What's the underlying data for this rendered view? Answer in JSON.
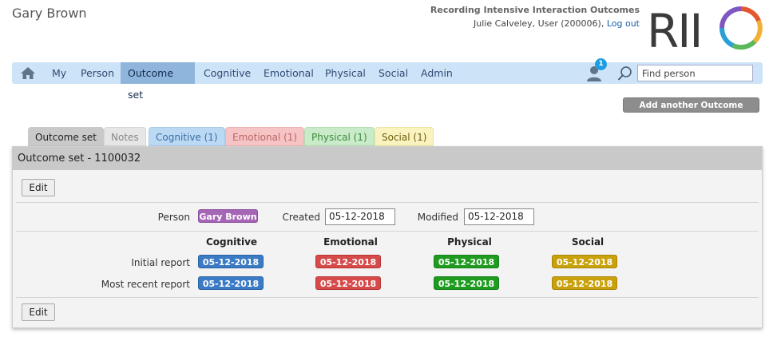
{
  "page": {
    "title": "Gary Brown"
  },
  "header": {
    "app_name": "Recording Intensive Interaction Outcomes",
    "user_text": "Julie Calveley, User (200006),",
    "logout_label": "Log out",
    "logo_text": "RII",
    "logo_icon": "riio-ring-logo"
  },
  "nav": {
    "home_icon": "home-icon",
    "items": [
      {
        "label": "My"
      },
      {
        "label": "Person"
      },
      {
        "label": "Outcome set"
      },
      {
        "label": "Cognitive"
      },
      {
        "label": "Emotional"
      },
      {
        "label": "Physical"
      },
      {
        "label": "Social"
      },
      {
        "label": "Admin"
      }
    ],
    "active_index": 2,
    "notification_count": "1",
    "search_placeholder": "Find person"
  },
  "actions": {
    "add_report_label": "Add another Outcome report"
  },
  "tabs": [
    {
      "label": "Outcome set"
    },
    {
      "label": "Notes"
    },
    {
      "label": "Cognitive (1)"
    },
    {
      "label": "Emotional (1)"
    },
    {
      "label": "Physical (1)"
    },
    {
      "label": "Social (1)"
    }
  ],
  "panel": {
    "title": "Outcome set - 1100032",
    "edit_label": "Edit",
    "person_label": "Person",
    "person_value": "Gary Brown",
    "created_label": "Created",
    "created_value": "05-12-2018",
    "modified_label": "Modified",
    "modified_value": "05-12-2018",
    "columns": [
      "Cognitive",
      "Emotional",
      "Physical",
      "Social"
    ],
    "rows": [
      {
        "label": "Initial report",
        "values": [
          "05-12-2018",
          "05-12-2018",
          "05-12-2018",
          "05-12-2018"
        ]
      },
      {
        "label": "Most recent report",
        "values": [
          "05-12-2018",
          "05-12-2018",
          "05-12-2018",
          "05-12-2018"
        ]
      }
    ]
  },
  "colors": {
    "nav_bg": "#cde3f7",
    "cognitive": "#3b7ac4",
    "emotional": "#d64a4a",
    "physical": "#1f9c1f",
    "social": "#c9a10a",
    "person": "#a566b5"
  }
}
